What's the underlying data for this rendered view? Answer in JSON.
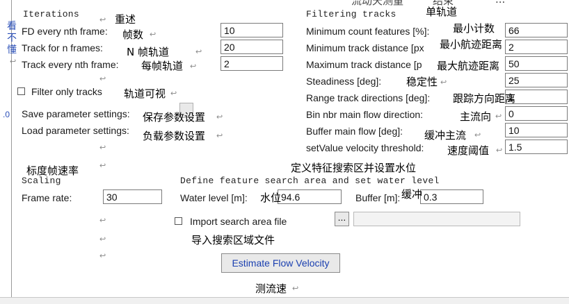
{
  "side": {
    "chars": [
      "看",
      "不",
      "懂"
    ],
    "arrow": "↩",
    "fragment": ".0"
  },
  "top_cutoff": [
    "流动天测量",
    "结束",
    "..."
  ],
  "iterations": {
    "heading": "Iterations",
    "heading_cn": "重述",
    "fd_label": "FD every nth frame:",
    "fd_cn": "帧数",
    "fd_value": "10",
    "track_n_label": "Track for n frames:",
    "track_n_cn": "N 帧轨道",
    "track_n_value": "20",
    "every_nth_label": "Track every nth frame:",
    "every_nth_cn": "每帧轨道",
    "every_nth_value": "2"
  },
  "filter_only": {
    "label": "Filter only tracks",
    "cn": "轨道可视",
    "checked": false
  },
  "save": {
    "label": "Save parameter settings:",
    "cn": "保存参数设置"
  },
  "load": {
    "label": "Load parameter settings:",
    "cn": "负载参数设置"
  },
  "filtering": {
    "heading": "Filtering tracks",
    "heading_cn": "单轨道",
    "rows": [
      {
        "label": "Minimum count features [%]:",
        "cn": "最小计数",
        "value": "66"
      },
      {
        "label": "Minimum track distance [px",
        "cn": "最小航迹距离",
        "value": "2"
      },
      {
        "label": "Maximum track distance [p",
        "cn": "最大航迹距离",
        "value": "50"
      },
      {
        "label": "Steadiness [deg]:",
        "cn": "稳定性",
        "value": "25"
      },
      {
        "label": "Range track directions [deg]:",
        "cn": "跟踪方向距离",
        "value": "1"
      },
      {
        "label": "Bin nbr main flow direction:",
        "cn": "主流向",
        "value": "0"
      },
      {
        "label": "Buffer main flow [deg]:",
        "cn": "缓冲主流",
        "value": "10"
      },
      {
        "label": "setValue velocity threshold:",
        "cn": "速度阈值",
        "value": "1.5"
      }
    ]
  },
  "scaling": {
    "heading_cn": "标度帧速率",
    "heading": "Scaling",
    "frame_rate_label": "Frame rate:",
    "frame_rate_value": "30"
  },
  "search": {
    "heading_cn": "定义特征搜索区并设置水位",
    "heading": "Define feature search area and set water level",
    "water_label": "Water level [m]:",
    "water_cn": "水位",
    "water_value": "94.6",
    "buffer_label": "Buffer [m]:",
    "buffer_cn": "缓冲",
    "buffer_value": "0.3",
    "import_label": "Import search area file",
    "import_cn": "导入搜索区域文件",
    "browse_label": "...",
    "file_path": ""
  },
  "estimate": {
    "label": "Estimate Flow Velocity",
    "cn": "测流速"
  }
}
